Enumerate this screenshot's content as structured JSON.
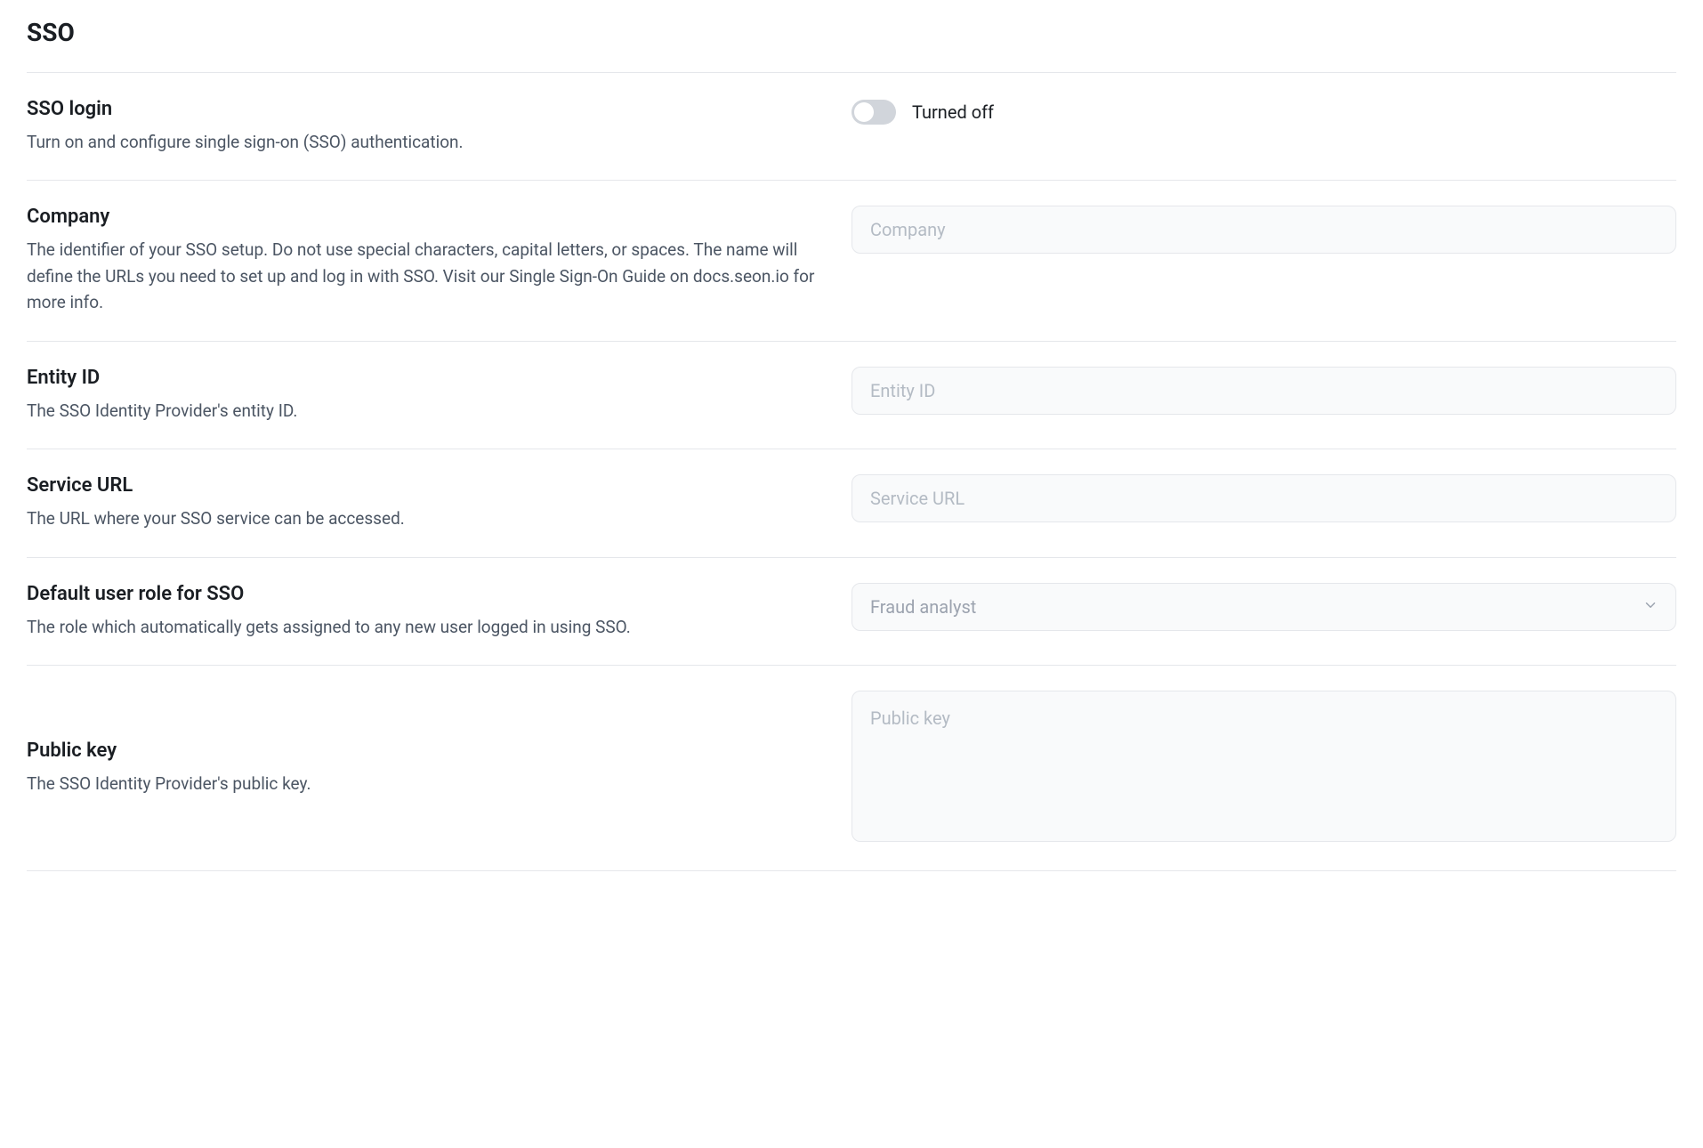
{
  "page": {
    "title": "SSO"
  },
  "sections": {
    "login": {
      "label": "SSO login",
      "desc": "Turn on and configure single sign-on (SSO) authentication.",
      "toggle_state": "Turned off"
    },
    "company": {
      "label": "Company",
      "desc": "The identifier of your SSO setup. Do not use special characters, capital letters, or spaces. The name will define the URLs you need to set up and log in with SSO. Visit our Single Sign-On Guide on docs.seon.io for more info.",
      "placeholder": "Company",
      "value": ""
    },
    "entity_id": {
      "label": "Entity ID",
      "desc": "The SSO Identity Provider's entity ID.",
      "placeholder": "Entity ID",
      "value": ""
    },
    "service_url": {
      "label": "Service URL",
      "desc": "The URL where your SSO service can be accessed.",
      "placeholder": "Service URL",
      "value": ""
    },
    "default_role": {
      "label": "Default user role for SSO",
      "desc": "The role which automatically gets assigned to any new user logged in using SSO.",
      "selected": "Fraud analyst"
    },
    "public_key": {
      "label": "Public key",
      "desc": "The SSO Identity Provider's public key.",
      "placeholder": "Public key",
      "value": ""
    }
  }
}
